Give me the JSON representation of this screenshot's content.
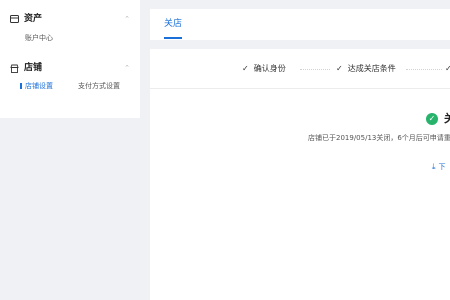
{
  "sidebar": {
    "assets": {
      "title": "资产",
      "icon": "card-icon",
      "items": [
        "账户中心"
      ]
    },
    "store": {
      "title": "店铺",
      "icon": "store-icon",
      "items": [
        "店铺设置",
        "支付方式设置"
      ],
      "active": "店铺设置"
    }
  },
  "tabs": [
    {
      "label": "关店",
      "active": true
    }
  ],
  "steps": [
    {
      "label": "确认身份",
      "icon": "check-icon"
    },
    {
      "label": "达成关店条件",
      "icon": "check-icon"
    },
    {
      "label": "",
      "icon": "check-icon"
    }
  ],
  "status": {
    "title": "关",
    "icon": "check-circle-icon",
    "color": "#27b36b"
  },
  "description": "店铺已于2019/05/13关闭，6个月后可申请重新",
  "download": {
    "label": "下",
    "icon": "download-icon"
  },
  "colors": {
    "accent": "#1a6fd9",
    "success": "#27b36b",
    "background": "#f0f1f5"
  }
}
